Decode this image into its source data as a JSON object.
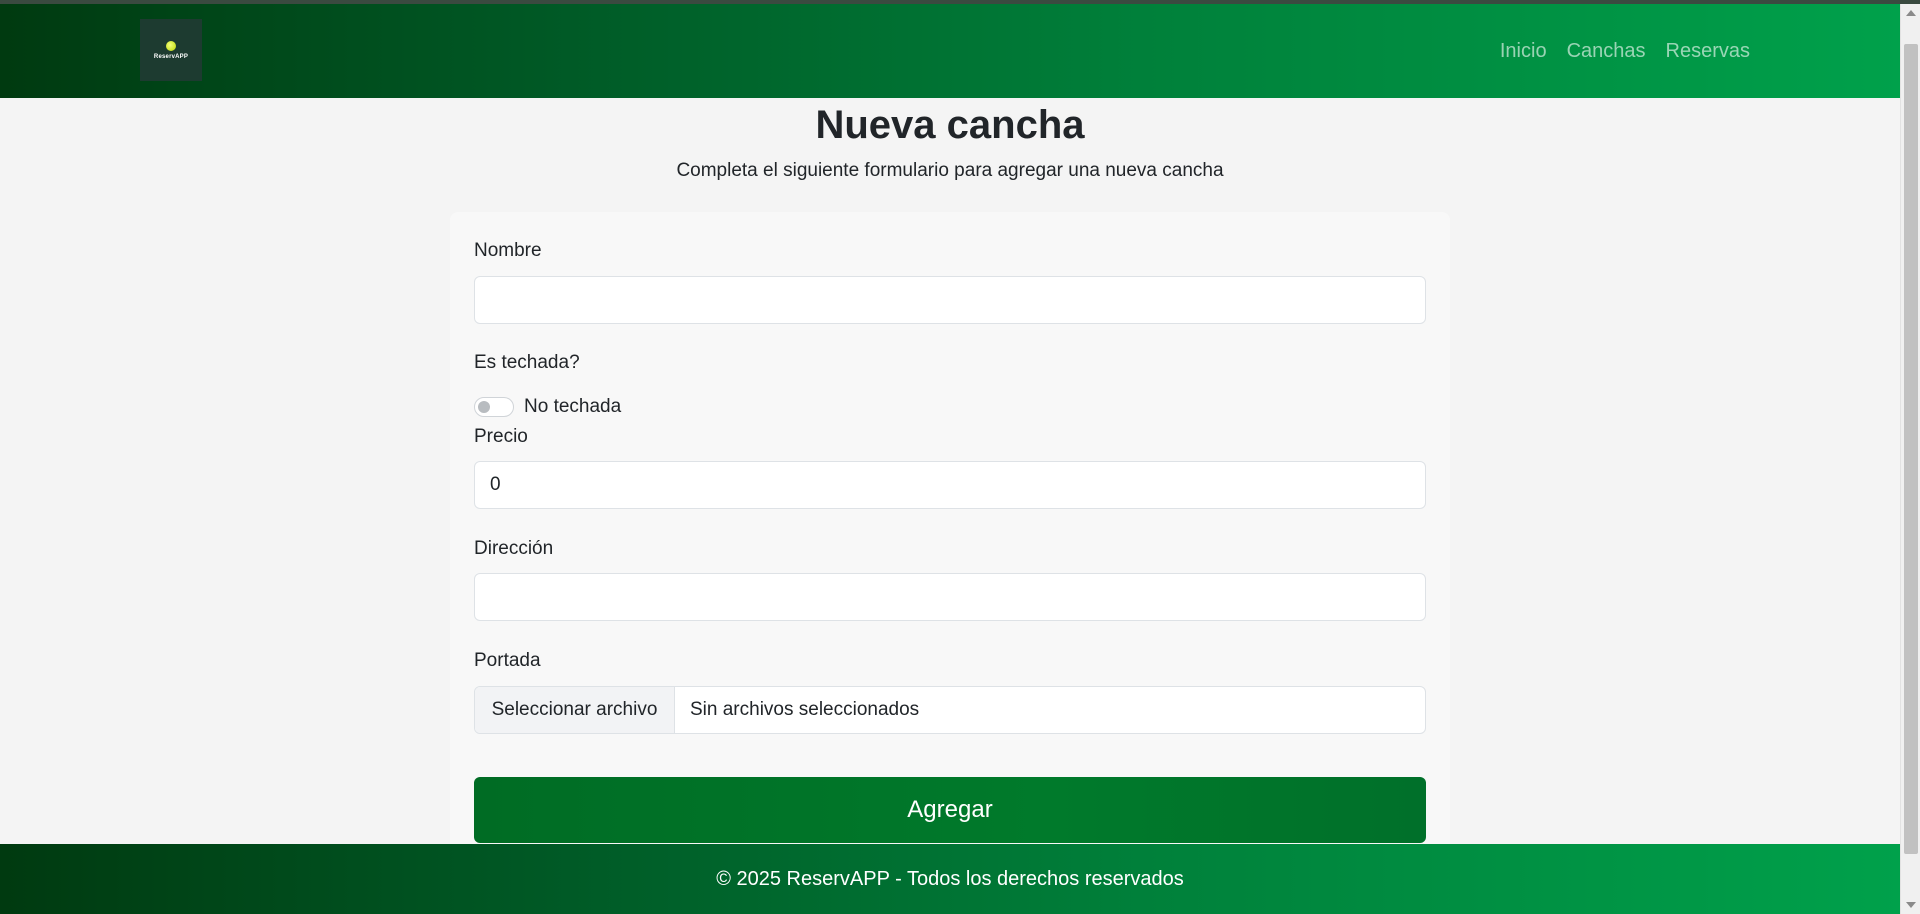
{
  "app": {
    "logo_text": "ReservAPP"
  },
  "nav": {
    "items": [
      {
        "label": "Inicio"
      },
      {
        "label": "Canchas"
      },
      {
        "label": "Reservas"
      }
    ]
  },
  "page": {
    "title": "Nueva cancha",
    "subtitle": "Completa el siguiente formulario para agregar una nueva cancha"
  },
  "form": {
    "nombre": {
      "label": "Nombre",
      "value": ""
    },
    "techada": {
      "label": "Es techada?",
      "toggle_text": "No techada",
      "checked": false
    },
    "precio": {
      "label": "Precio",
      "value": "0"
    },
    "direccion": {
      "label": "Dirección",
      "value": ""
    },
    "portada": {
      "label": "Portada",
      "button_label": "Seleccionar archivo",
      "status": "Sin archivos seleccionados"
    },
    "submit_label": "Agregar"
  },
  "footer": {
    "text": "© 2025 ReservAPP - Todos los derechos reservados"
  },
  "colors": {
    "brand_green": "#00803a",
    "button_green": "#007a2b"
  }
}
